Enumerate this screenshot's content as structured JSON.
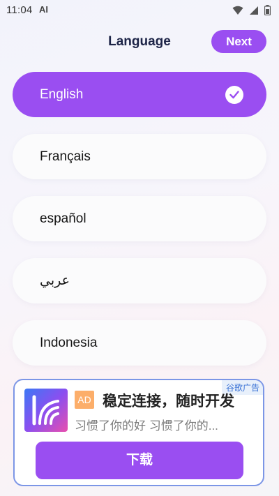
{
  "status_bar": {
    "time": "11:04",
    "ai_label": "AI"
  },
  "header": {
    "title": "Language",
    "next_label": "Next"
  },
  "languages": [
    {
      "label": "English",
      "selected": true
    },
    {
      "label": "Français",
      "selected": false
    },
    {
      "label": "español",
      "selected": false
    },
    {
      "label": "عربي",
      "selected": false
    },
    {
      "label": "Indonesia",
      "selected": false
    }
  ],
  "ad": {
    "tag": "谷歌广告",
    "badge": "AD",
    "title": "稳定连接，随时开发",
    "description": "习惯了你的好 习惯了你的...",
    "button_label": "下载"
  },
  "colors": {
    "accent": "#9a4ef1",
    "ad_border": "#7c96e6",
    "ad_badge": "#fcae6a"
  }
}
